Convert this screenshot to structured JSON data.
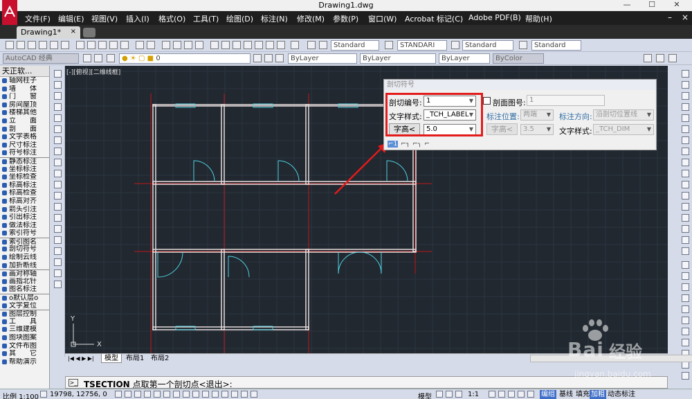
{
  "window": {
    "title": "Drawing1.dwg"
  },
  "menu": {
    "items": [
      "文件(F)",
      "编辑(E)",
      "视图(V)",
      "插入(I)",
      "格式(O)",
      "工具(T)",
      "绘图(D)",
      "标注(N)",
      "修改(M)",
      "参数(P)",
      "窗口(W)",
      "Acrobat 标记(C)",
      "Adobe PDF(B)",
      "帮助(H)"
    ]
  },
  "doc_tabs": {
    "active": "Drawing1*"
  },
  "toolbar1": {
    "style1": "Standard",
    "style2": "STANDARI",
    "style3": "Standard",
    "style4": "Standard"
  },
  "toolbar2": {
    "workspace": "AutoCAD 经典",
    "layer": "0",
    "color": "ByLayer",
    "linetype": "ByLayer",
    "lineweight": "ByLayer",
    "plotstyle": "ByColor"
  },
  "left_panel": {
    "title": "天正软...",
    "items": [
      "轴网柱子",
      "墙　　体",
      "门　　窗",
      "房间屋顶",
      "楼梯其他",
      "立　　面",
      "剖　　面",
      "文字表格",
      "尺寸标注",
      "符号标注",
      "静态标注",
      "坐标标注",
      "坐标检查",
      "标高标注",
      "标高检查",
      "标高对齐",
      "箭头引注",
      "引出标注",
      "做法标注",
      "索引符号",
      "索引图名",
      "剖切符号",
      "绘制云线",
      "加折断线",
      "画对称轴",
      "画指北针",
      "图名标注",
      "o默认层o",
      "文字复位",
      "图层控制",
      "工　　具",
      "三维建模",
      "图块图案",
      "文件布图",
      "其　　它",
      "帮助演示"
    ]
  },
  "canvas": {
    "view_label": "[-][俯视][二维线框]",
    "axis_x": "X",
    "axis_y": "Y"
  },
  "dialog": {
    "title": "剖切符号",
    "cut_no_label": "剖切编号:",
    "cut_no_value": "1",
    "section_fig_label": "剖面图号:",
    "section_fig_value": "1",
    "text_style_label": "文字样式:",
    "text_style_value": "_TCH_LABEL",
    "label_pos_label": "标注位置:",
    "label_pos_value": "两端",
    "label_dir_label": "标注方向:",
    "label_dir_value": "沿剖切位置线",
    "text_height_btn": "字高<",
    "text_height_value": "5.0",
    "text_height_btn2": "字高<",
    "text_height_value2": "3.5",
    "text_style2_label": "文字样式:",
    "text_style2_value": "_TCH_DIM"
  },
  "layout_tabs": {
    "model": "模型",
    "layout1": "布局1",
    "layout2": "布局2"
  },
  "command": {
    "cmd": "TSECTION",
    "prompt": "点取第一个剖切点<退出>:"
  },
  "status": {
    "scale": "比例 1:100",
    "coords": "19798, 12756, 0",
    "model": "模型",
    "zoom": "1:1",
    "btn_bianzu": "编组",
    "btn_jixian": "基线",
    "btn_tianchong": "填充",
    "btn_jiacu": "加粗",
    "btn_dongtai": "动态标注"
  },
  "watermark": {
    "text1": "Bai",
    "text2": "经验",
    "url": "jingyan.baidu.com"
  },
  "colors": {
    "canvas": "#212830",
    "grid": "#2c3540",
    "red_axis": "#c01818",
    "wall": "#e8dede",
    "door": "#4fd1e0",
    "highlight": "#e31b1b"
  }
}
